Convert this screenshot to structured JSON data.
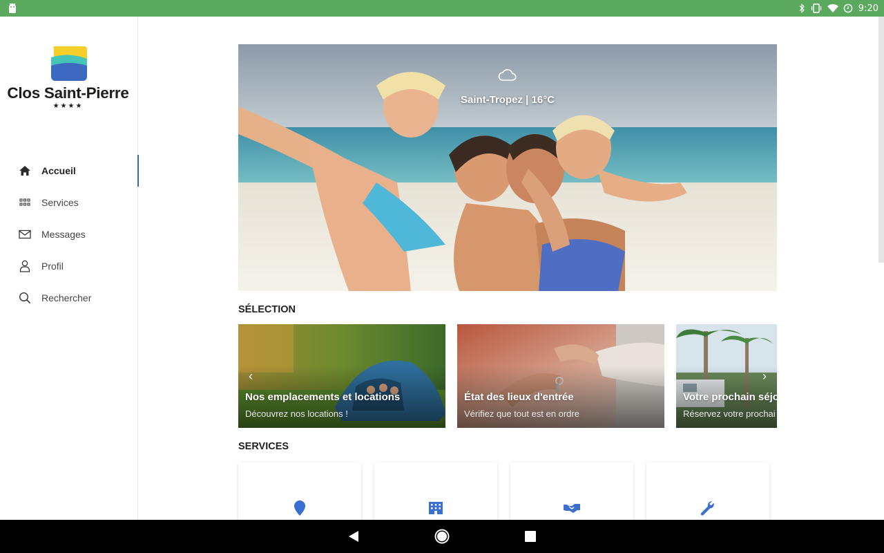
{
  "status_bar": {
    "time": "9:20"
  },
  "brand": {
    "name": "Clos Saint-Pierre",
    "stars": "★★★★"
  },
  "sidebar": {
    "items": [
      {
        "label": "Accueil",
        "icon": "home-icon",
        "active": true
      },
      {
        "label": "Services",
        "icon": "grid-icon",
        "active": false
      },
      {
        "label": "Messages",
        "icon": "envelope-icon",
        "active": false
      },
      {
        "label": "Profil",
        "icon": "person-icon",
        "active": false
      },
      {
        "label": "Rechercher",
        "icon": "search-icon",
        "active": false
      }
    ]
  },
  "hero": {
    "weather_icon": "cloud-icon",
    "weather_text": "Saint-Tropez | 16°C"
  },
  "selection": {
    "title": "SÉLECTION",
    "cards": [
      {
        "title": "Nos emplacements et locations",
        "subtitle": "Découvrez nos locations !"
      },
      {
        "title": "État des lieux d'entrée",
        "subtitle": "Vérifiez que tout est en ordre"
      },
      {
        "title": "Votre prochain séjo",
        "subtitle": "Réservez votre prochai"
      }
    ]
  },
  "services": {
    "title": "SERVICES",
    "items": [
      {
        "icon": "map-pin-icon"
      },
      {
        "icon": "building-icon"
      },
      {
        "icon": "handshake-icon"
      },
      {
        "icon": "wrench-icon"
      }
    ]
  },
  "colors": {
    "status_bar": "#5ba85f",
    "accent": "#3d62b0",
    "icon_blue": "#3b6fd0"
  }
}
